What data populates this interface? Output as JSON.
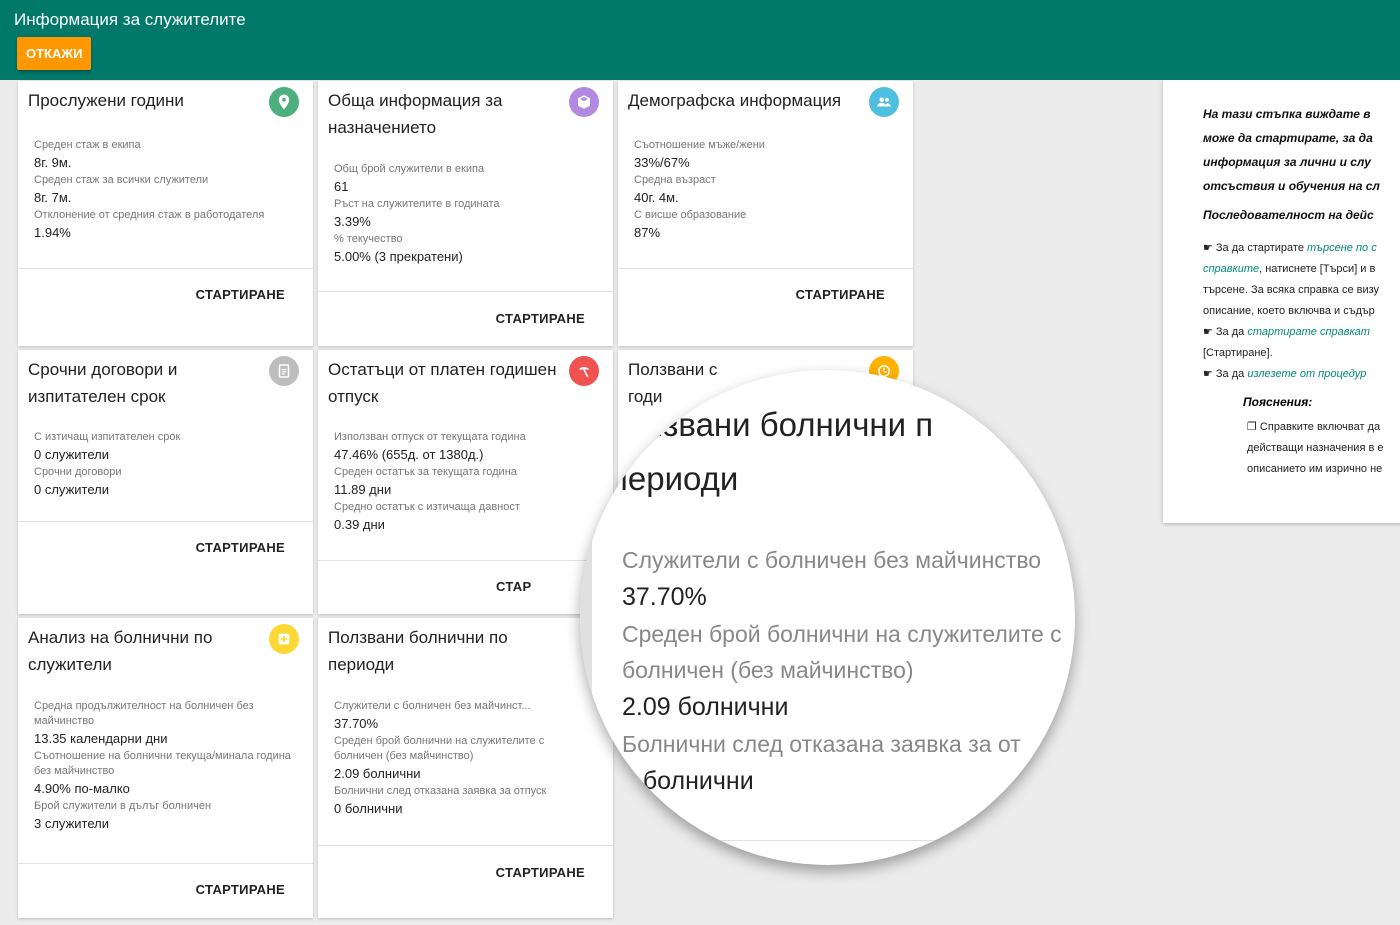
{
  "header": {
    "title": "Информация за служителите",
    "cancel_label": "ОТКАЖИ",
    "background": "#00796b",
    "cancel_color": "#ff9800"
  },
  "start_label": "СТАРТИРАНЕ",
  "cards": {
    "service_years": {
      "title": "Прослужени години",
      "icon": "location-pin-icon",
      "icon_color": "#4caf7d",
      "stats": [
        {
          "label": "Среден стаж в екипа",
          "value": "8г. 9м."
        },
        {
          "label": "Среден стаж за всички служители",
          "value": "8г. 7м."
        },
        {
          "label": "Отклонение от средния стаж в работодателя",
          "value": "1.94%"
        }
      ]
    },
    "appointment": {
      "title": "Обща информация за назначението",
      "icon": "box-icon",
      "icon_color": "#b388e0",
      "stats": [
        {
          "label": "Общ брой служители в екипа",
          "value": "61"
        },
        {
          "label": "Ръст на служителите в годината",
          "value": "3.39%"
        },
        {
          "label": "% текучество",
          "value": "5.00% (3 прекратени)"
        }
      ]
    },
    "demographic": {
      "title": "Демографска информация",
      "icon": "people-icon",
      "icon_color": "#4fbfe0",
      "stats": [
        {
          "label": "Съотношение мъже/жени",
          "value": "33%/67%"
        },
        {
          "label": "Средна възраст",
          "value": "40г. 4м."
        },
        {
          "label": "С висше образование",
          "value": "87%"
        }
      ]
    },
    "contracts": {
      "title": "Срочни договори и изпитателен срок",
      "icon": "clipboard-icon",
      "icon_color": "#bdbdbd",
      "stats": [
        {
          "label": "С изтичащ изпитателен срок",
          "value": "0 служители"
        },
        {
          "label": "Срочни договори",
          "value": "0 служители"
        }
      ]
    },
    "leave": {
      "title": "Остатъци от платен годишен отпуск",
      "icon": "beach-icon",
      "icon_color": "#ef5350",
      "stats": [
        {
          "label": "Използван отпуск от текущата година",
          "value": "47.46% (655д. от 1380д.)"
        },
        {
          "label": "Среден остатък за текущата година",
          "value": "11.89 дни"
        },
        {
          "label": "Средно остатък с изтичаща давност",
          "value": "0.39 дни"
        }
      ],
      "start_partial": "СТАР"
    },
    "partial": {
      "title_line1": "Ползвани ",
      "title_line1_tail": "с",
      "title_line2": "годи",
      "icon": "clock-icon",
      "icon_color": "#ffb300"
    },
    "sick_analysis": {
      "title": "Анализ на болнични по служители",
      "icon": "plus-icon",
      "icon_color": "#fdd835",
      "stats": [
        {
          "label": "Средна продължителност на болничен без майчинство",
          "value": "13.35 календарни дни"
        },
        {
          "label": "Съотношение на болнични текуща/минала година без майчинство",
          "value": "4.90% по-малко"
        },
        {
          "label": "Брой служители в дълъг болничен",
          "value": "3 служители"
        }
      ]
    },
    "sick_periods": {
      "title": "Ползвани болнични по периоди",
      "stats": [
        {
          "label": "Служители с болничен без майчинст...",
          "value": "37.70%"
        },
        {
          "label": "Среден брой болнични на служителите с болничен (без майчинство)",
          "value": "2.09 болнични"
        },
        {
          "label": "Болнични след отказана заявка за отпуск",
          "value": "0 болнични"
        }
      ]
    }
  },
  "magnifier": {
    "title_line1": "юлзвани болнични п",
    "title_line2": "периоди",
    "stats": [
      {
        "label": "Служители с болничен без майчинство",
        "value": "37.70%"
      },
      {
        "label": "Среден брой болнични на служителите с",
        "label2": "болничен (без майчинство)",
        "value": "2.09 болнични"
      },
      {
        "label": "Болнични след отказана заявка за от",
        "value": "0 болнични"
      }
    ]
  },
  "help": {
    "intro": [
      "На тази стъпка виждате в",
      "може да стартирате, за да",
      "информация за лични и слу",
      "отсъствия и обучения на сл"
    ],
    "sequence_title": "Последователност на дейс",
    "line1_a": "☛ За да стартирате ",
    "line1_link": "търсене по с",
    "line2_link": "справките",
    "line2_b": ", натиснете [Търси] и в",
    "line3": "търсене. За всяка справка се визу",
    "line4": "описание, което включва и съдър",
    "line5_a": "☛ За да ",
    "line5_link": "стартирате справкат",
    "line6": "[Стартиране].",
    "line7_a": "☛ За да ",
    "line7_link": "излезете от процедур",
    "explanations_title": "Пояснения:",
    "note1": "❐ Справките включват да",
    "note2": "действащи назначения в е",
    "note3": "описанието им изрично не"
  }
}
